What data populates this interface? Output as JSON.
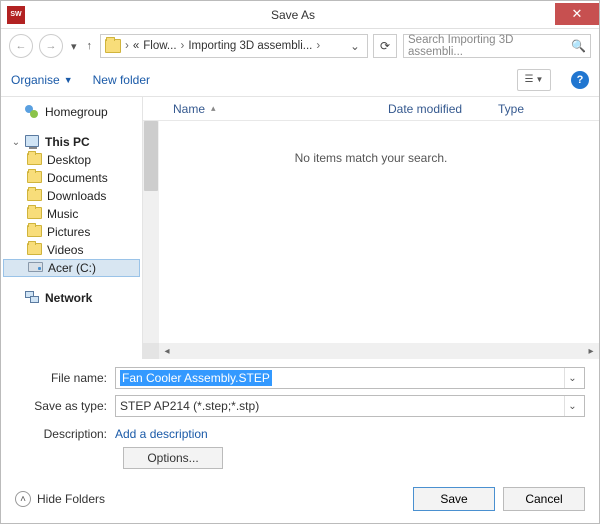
{
  "window": {
    "title": "Save As"
  },
  "nav": {
    "breadcrumb": {
      "seg1": "Flow...",
      "seg2": "Importing 3D assembli..."
    },
    "search_placeholder": "Search Importing 3D assembli..."
  },
  "toolbar": {
    "organise": "Organise",
    "newfolder": "New folder"
  },
  "columns": {
    "name": "Name",
    "date": "Date modified",
    "type": "Type"
  },
  "empty_message": "No items match your search.",
  "tree": {
    "homegroup": "Homegroup",
    "thispc": "This PC",
    "items": [
      "Desktop",
      "Documents",
      "Downloads",
      "Music",
      "Pictures",
      "Videos",
      "Acer (C:)"
    ],
    "network": "Network"
  },
  "form": {
    "filename_label": "File name:",
    "filename_value": "Fan Cooler Assembly.STEP",
    "savetype_label": "Save as type:",
    "savetype_value": "STEP AP214 (*.step;*.stp)",
    "description_label": "Description:",
    "description_link": "Add a description",
    "options_btn": "Options..."
  },
  "footer": {
    "hidefolders": "Hide Folders",
    "save": "Save",
    "cancel": "Cancel"
  }
}
